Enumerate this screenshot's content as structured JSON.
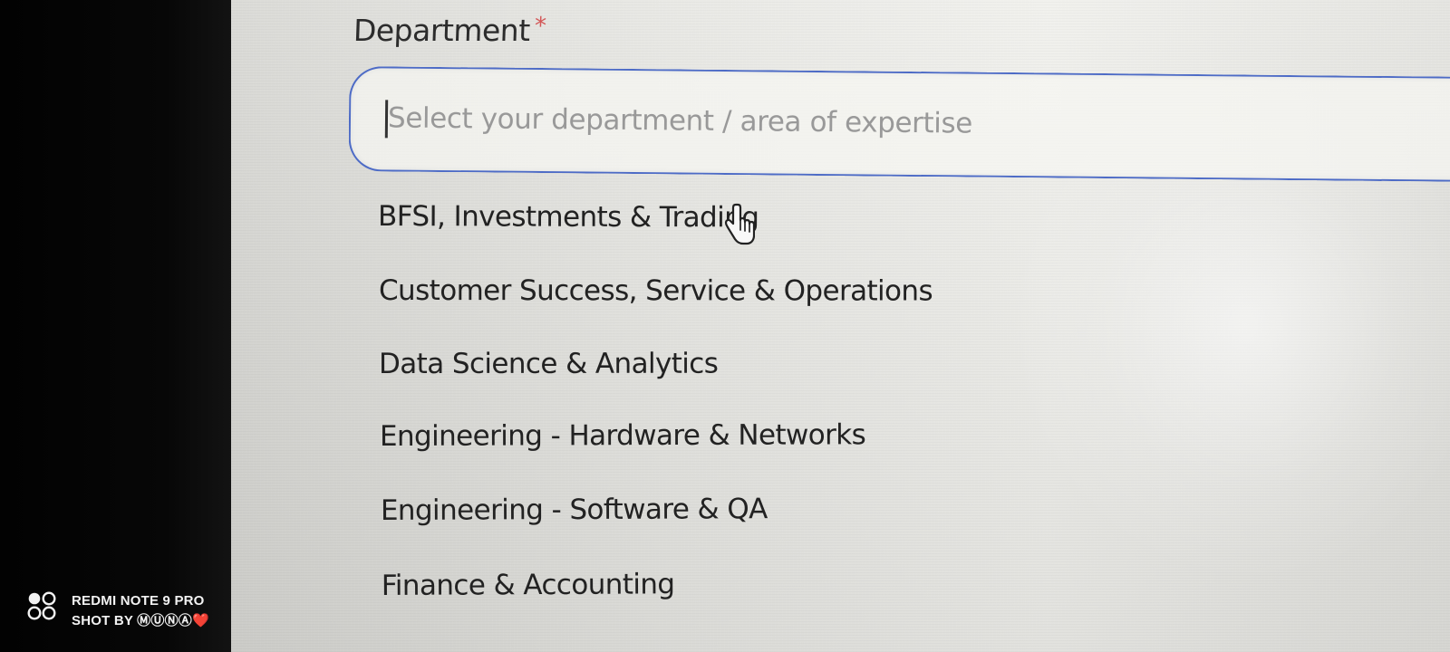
{
  "form": {
    "department_label": "Department",
    "required_marker": "*",
    "department_placeholder": "Select your department / area of expertise",
    "department_options": [
      "BFSI, Investments & Trading",
      "Customer Success, Service & Operations",
      "Data Science & Analytics",
      "Engineering - Hardware & Networks",
      "Engineering - Software & QA",
      "Finance & Accounting"
    ]
  },
  "cursor": {
    "icon": "hand-pointer-icon"
  },
  "watermark": {
    "line1": "REDMI NOTE 9 PRO",
    "line2": "SHOT BY ⓂⓊⓃⒶ❤️",
    "logo_icon": "camera-logo-icon"
  },
  "colors": {
    "input_focus_border": "#4d6bc6",
    "required_star": "#d35757",
    "option_text": "#222222",
    "placeholder_text": "#999999",
    "bezel": "#050505"
  }
}
